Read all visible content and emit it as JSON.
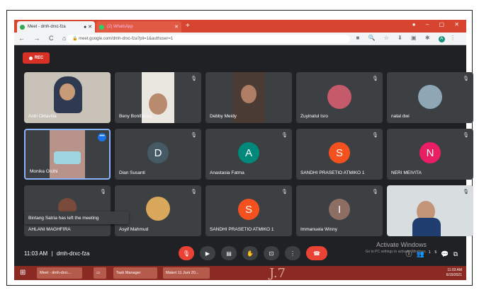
{
  "browser": {
    "tab_active": "Meet - dmh-drxc-fza",
    "tab_inactive": "(2) WhatsApp",
    "url": "meet.google.com/dmh-drxc-fza?pli=1&authuser=1",
    "new_tab": "+",
    "profile_initial": "A"
  },
  "meet": {
    "rec_label": "REC",
    "toast": "Bintang Satria has left the meeting",
    "time": "11:03 AM",
    "separator": "|",
    "meeting_code": "dmh-drxc-fza",
    "activate_title": "Activate Windows",
    "activate_sub": "Go to PC settings to activate Windows.",
    "participants_badge": "15",
    "participants": [
      {
        "name": "Astri Oktavilia"
      },
      {
        "name": "Beny Bonifasius"
      },
      {
        "name": "Debby Meidy"
      },
      {
        "name": "Zuyinatul Isro"
      },
      {
        "name": "natal dwi"
      },
      {
        "name": "Monika Oisthi"
      },
      {
        "name": "Dian Susanti",
        "letter": "D",
        "color": "#455a64"
      },
      {
        "name": "Anastasia Fatma",
        "letter": "A",
        "color": "#00897b"
      },
      {
        "name": "SANDHI PRASETIO ATMIKO 1",
        "letter": "S",
        "color": "#f4511e"
      },
      {
        "name": "NERI MEIVITA",
        "letter": "N",
        "color": "#e91e63"
      },
      {
        "name": "AHLANI MAGHFIRA"
      },
      {
        "name": "Asyif Mahmud"
      },
      {
        "name": "SANDHI PRASETIO ATMIKO 1",
        "letter": "S",
        "color": "#f4511e"
      },
      {
        "name": "Immanuela Winny",
        "letter": "I",
        "color": "#8d6e63"
      },
      {
        "name": ""
      }
    ]
  },
  "taskbar": {
    "items": [
      "Meet - dmh-drxc...",
      "",
      "Task Manager",
      "Materi 11 Juni 20..."
    ],
    "time": "11:03 AM",
    "date": "6/15/2021"
  }
}
